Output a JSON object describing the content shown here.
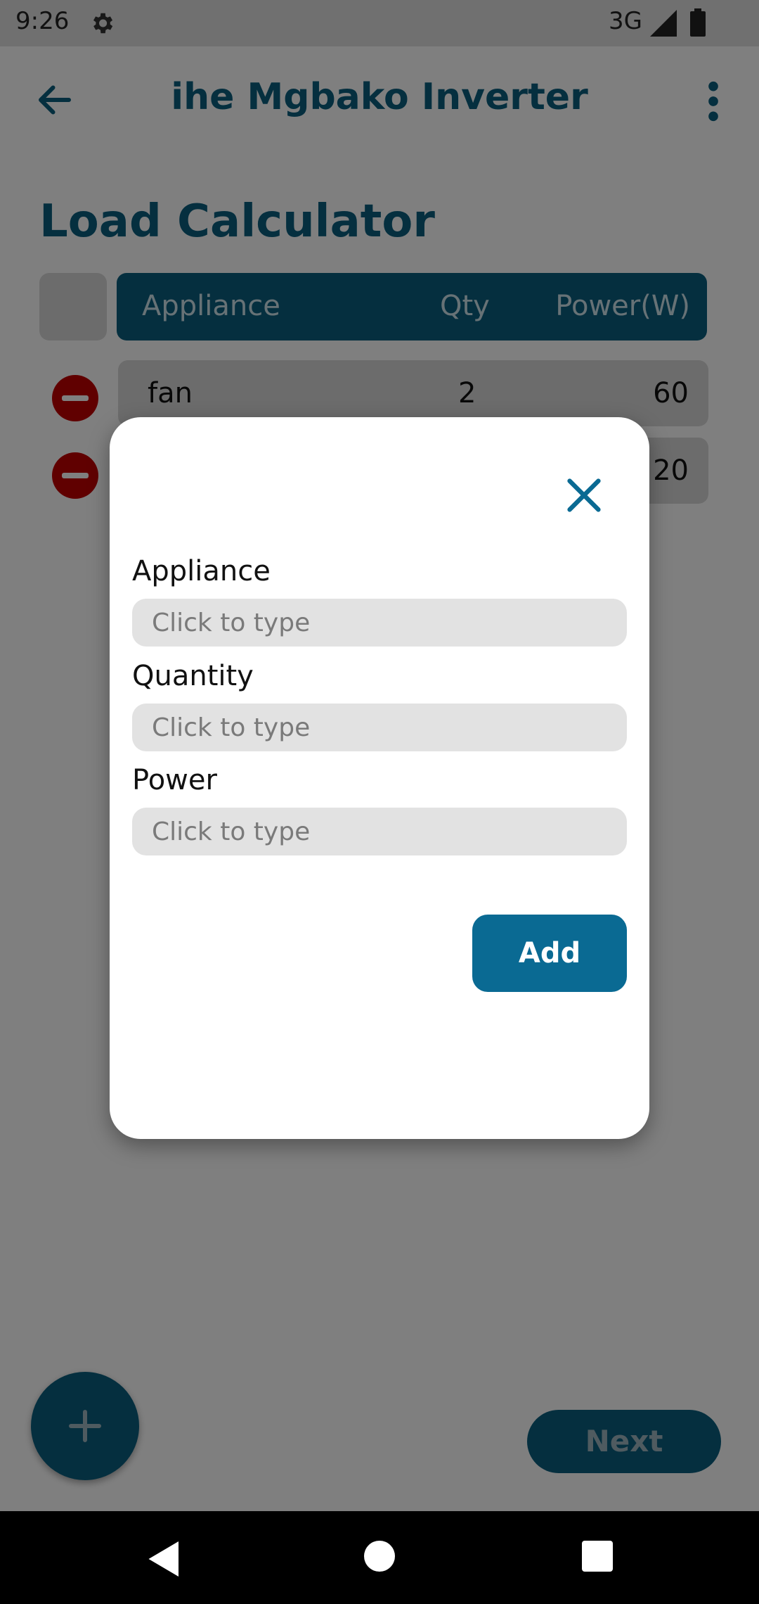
{
  "status_bar": {
    "time": "9:26",
    "network": "3G"
  },
  "app_bar": {
    "title": "ihe Mgbako Inverter"
  },
  "page": {
    "heading": "Load Calculator"
  },
  "table": {
    "headers": [
      "Appliance",
      "Qty",
      "Power(W)"
    ],
    "rows": [
      {
        "appliance": "fan",
        "qty": "2",
        "power": "60"
      },
      {
        "appliance": "",
        "qty": "",
        "power": "20"
      }
    ]
  },
  "dialog": {
    "fields": [
      {
        "label": "Appliance",
        "placeholder": "Click to type",
        "value": ""
      },
      {
        "label": "Quantity",
        "placeholder": "Click to type",
        "value": ""
      },
      {
        "label": "Power",
        "placeholder": "Click to type",
        "value": ""
      }
    ],
    "add_label": "Add"
  },
  "footer": {
    "next_label": "Next"
  },
  "colors": {
    "primary": "#0a5f7f",
    "danger": "#c00000",
    "button": "#0a6a93"
  },
  "icons": {
    "back": "arrow-left-icon",
    "more": "more-vert-icon",
    "close": "close-icon",
    "fab": "plus-icon",
    "remove": "minus-circle-icon",
    "gear": "gear-icon"
  }
}
